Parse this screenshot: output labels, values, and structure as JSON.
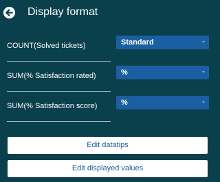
{
  "header": {
    "title": "Display format",
    "back_icon": "back-arrow-circle-icon"
  },
  "rows": [
    {
      "label": "COUNT(Solved tickets)",
      "selected": "Standard"
    },
    {
      "label": "SUM(% Satisfaction rated)",
      "selected": "%"
    },
    {
      "label": "SUM(% Satisfaction score)",
      "selected": "%"
    }
  ],
  "buttons": {
    "edit_datatips": "Edit datatips",
    "edit_displayed_values": "Edit displayed values"
  },
  "colors": {
    "background": "#0a3f4c",
    "select": "#1b5fa3",
    "button_text": "#1b5fa3"
  }
}
